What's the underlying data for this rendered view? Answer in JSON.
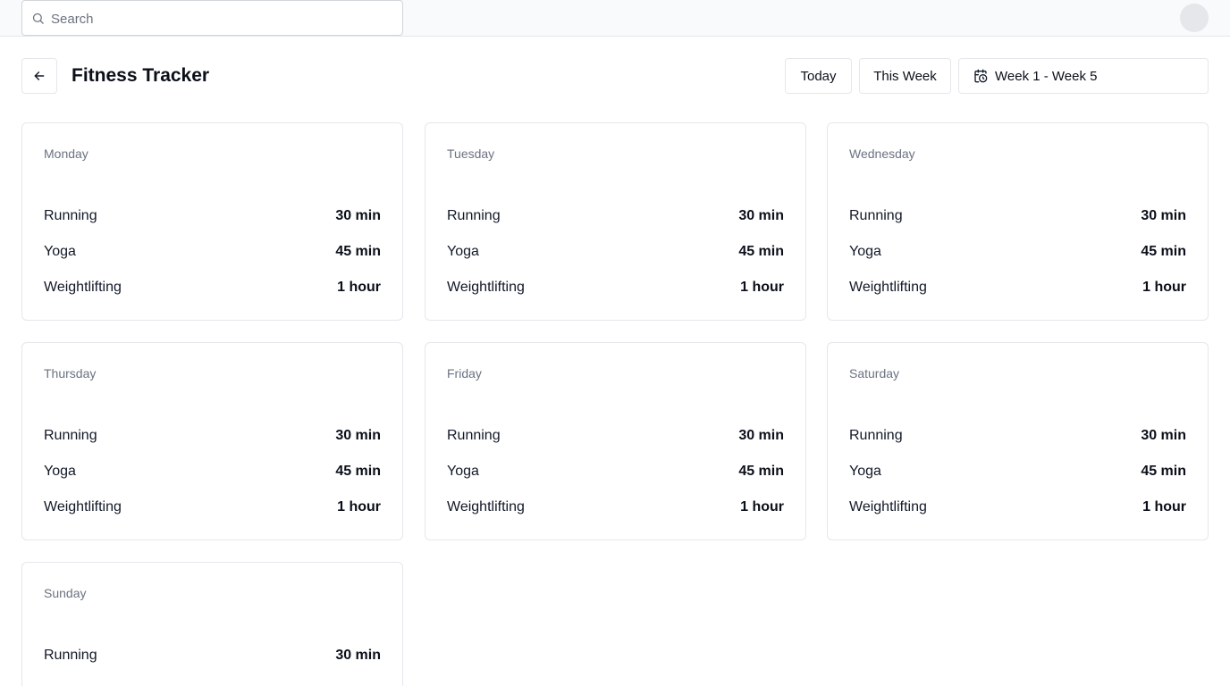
{
  "search": {
    "placeholder": "Search",
    "value": ""
  },
  "header": {
    "title": "Fitness Tracker",
    "today_label": "Today",
    "this_week_label": "This Week",
    "date_range": "Week 1 - Week 5"
  },
  "days": [
    {
      "name": "Monday",
      "activities": [
        {
          "name": "Running",
          "duration": "30 min"
        },
        {
          "name": "Yoga",
          "duration": "45 min"
        },
        {
          "name": "Weightlifting",
          "duration": "1 hour"
        }
      ]
    },
    {
      "name": "Tuesday",
      "activities": [
        {
          "name": "Running",
          "duration": "30 min"
        },
        {
          "name": "Yoga",
          "duration": "45 min"
        },
        {
          "name": "Weightlifting",
          "duration": "1 hour"
        }
      ]
    },
    {
      "name": "Wednesday",
      "activities": [
        {
          "name": "Running",
          "duration": "30 min"
        },
        {
          "name": "Yoga",
          "duration": "45 min"
        },
        {
          "name": "Weightlifting",
          "duration": "1 hour"
        }
      ]
    },
    {
      "name": "Thursday",
      "activities": [
        {
          "name": "Running",
          "duration": "30 min"
        },
        {
          "name": "Yoga",
          "duration": "45 min"
        },
        {
          "name": "Weightlifting",
          "duration": "1 hour"
        }
      ]
    },
    {
      "name": "Friday",
      "activities": [
        {
          "name": "Running",
          "duration": "30 min"
        },
        {
          "name": "Yoga",
          "duration": "45 min"
        },
        {
          "name": "Weightlifting",
          "duration": "1 hour"
        }
      ]
    },
    {
      "name": "Saturday",
      "activities": [
        {
          "name": "Running",
          "duration": "30 min"
        },
        {
          "name": "Yoga",
          "duration": "45 min"
        },
        {
          "name": "Weightlifting",
          "duration": "1 hour"
        }
      ]
    },
    {
      "name": "Sunday",
      "activities": [
        {
          "name": "Running",
          "duration": "30 min"
        }
      ]
    }
  ],
  "icons": {
    "search": "search-icon",
    "back": "arrow-left-icon",
    "calendar": "calendar-clock-icon"
  }
}
